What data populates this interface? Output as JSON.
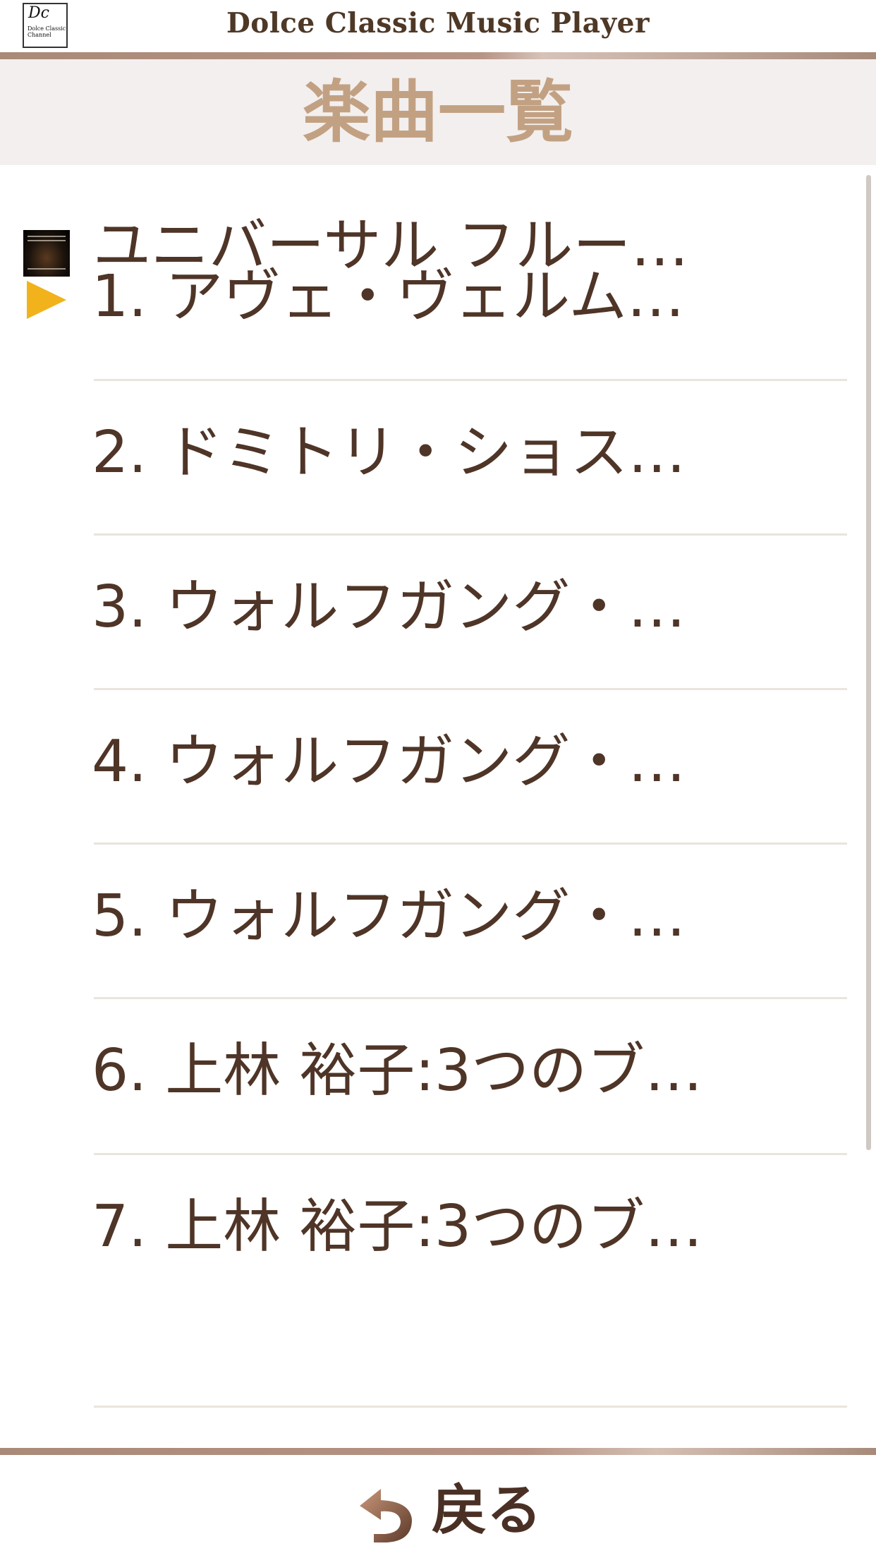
{
  "header": {
    "logo_text": "Dolce Classic Channel",
    "app_title": "Dolce Classic Music Player"
  },
  "page": {
    "title": "楽曲一覧"
  },
  "album": {
    "title": "ユニバーサル フルー…"
  },
  "tracks": [
    {
      "label": "1. アヴェ・ヴェルム…",
      "playing": true
    },
    {
      "label": "2. ドミトリ・ショス…",
      "playing": false
    },
    {
      "label": "3. ウォルフガング・…",
      "playing": false
    },
    {
      "label": "4. ウォルフガング・…",
      "playing": false
    },
    {
      "label": "5. ウォルフガング・…",
      "playing": false
    },
    {
      "label": "6. 上林 裕子:3つのブ…",
      "playing": false
    },
    {
      "label": "7. 上林 裕子:3つのブ…",
      "playing": false
    }
  ],
  "footer": {
    "back_label": "戻る"
  },
  "colors": {
    "text": "#4f3527",
    "title_accent": "#c2a183",
    "play_marker": "#f1b21c",
    "band": "#f3efee"
  }
}
